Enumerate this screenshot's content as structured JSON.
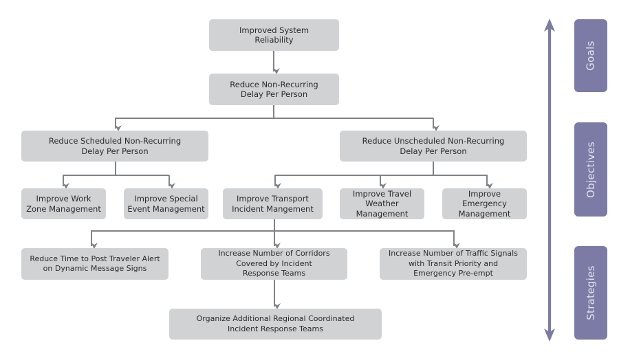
{
  "diagram": {
    "nodes": {
      "goal": "Improved System\nReliability",
      "objective_main": "Reduce Non-Recurring\nDelay Per Person",
      "objective_scheduled": "Reduce Scheduled Non-Recurring\nDelay Per Person",
      "objective_unscheduled": "Reduce Unscheduled Non-Recurring\nDelay Per Person",
      "work_zone": "Improve Work\nZone Management",
      "special_event": "Improve Special\nEvent Management",
      "transport_incident": "Improve Transport\nIncident Mangement",
      "travel_weather": "Improve Travel\nWeather\nManagement",
      "emergency": "Improve Emergency\nManagement",
      "traveler_alert": "Reduce Time to Post Traveler Alert\non Dynamic Message Signs",
      "corridors": "Increase Number of Corridors\nCovered by Incident\nResponse Teams",
      "traffic_signals": "Increase Number of Traffic Signals\nwith Transit Priority and\nEmergency Pre-empt",
      "regional_teams": "Organize Additional Regional Coordinated\nIncident Response Teams"
    },
    "edges": [
      [
        "goal",
        "objective_main"
      ],
      [
        "objective_main",
        "objective_scheduled"
      ],
      [
        "objective_main",
        "objective_unscheduled"
      ],
      [
        "objective_scheduled",
        "work_zone"
      ],
      [
        "objective_scheduled",
        "special_event"
      ],
      [
        "objective_unscheduled",
        "transport_incident"
      ],
      [
        "objective_unscheduled",
        "travel_weather"
      ],
      [
        "objective_unscheduled",
        "emergency"
      ],
      [
        "transport_incident",
        "traveler_alert"
      ],
      [
        "transport_incident",
        "corridors"
      ],
      [
        "transport_incident",
        "traffic_signals"
      ],
      [
        "corridors",
        "regional_teams"
      ]
    ],
    "tiers": [
      "Goals",
      "Objectives",
      "Strategies"
    ],
    "colors": {
      "node_fill": "#d1d2d4",
      "connector": "#808285",
      "tier_fill": "#7b7ba5",
      "tier_text": "#e3e3ef"
    }
  }
}
